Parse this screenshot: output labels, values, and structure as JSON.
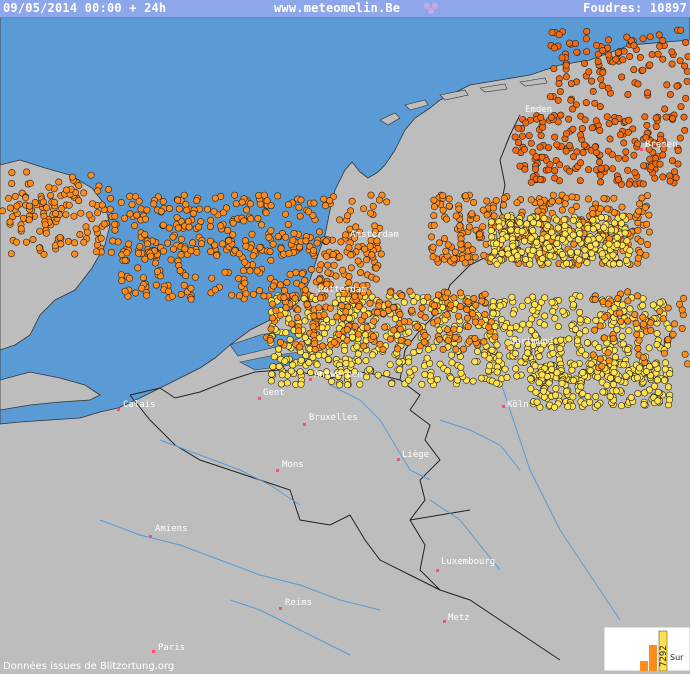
{
  "header": {
    "datetime": "09/05/2014 00:00 + 24h",
    "site": "www.meteomelin.Be",
    "strikes_label": "Foudres: 10897"
  },
  "footer": {
    "source": "Données issues de Blitzortung.org"
  },
  "legend": {
    "histogram_label": "7292",
    "side_label": "Sur"
  },
  "colors": {
    "sea": "#5b9bd5",
    "land": "#bdbdbd",
    "recent_strike": "#ffe14d",
    "older_strike": "#ff8c1a",
    "oldest_strike": "#f26a0f"
  },
  "cities": [
    {
      "id": "emden",
      "label": "Emden"
    },
    {
      "id": "bremen",
      "label": "Bremen"
    },
    {
      "id": "amsterdam",
      "label": "Amsterdam"
    },
    {
      "id": "rotterdam",
      "label": "Rotterdam"
    },
    {
      "id": "dortmund",
      "label": "Dortmund"
    },
    {
      "id": "antwerpen",
      "label": "Antwerpen"
    },
    {
      "id": "gent",
      "label": "Gent"
    },
    {
      "id": "calais",
      "label": "Calais"
    },
    {
      "id": "bruxelles",
      "label": "Bruxelles"
    },
    {
      "id": "koln",
      "label": "Köln"
    },
    {
      "id": "liege",
      "label": "Liège"
    },
    {
      "id": "mons",
      "label": "Mons"
    },
    {
      "id": "amiens",
      "label": "Amiens"
    },
    {
      "id": "luxembourg",
      "label": "Luxembourg"
    },
    {
      "id": "reims",
      "label": "Reims"
    },
    {
      "id": "metz",
      "label": "Metz"
    },
    {
      "id": "paris",
      "label": "Paris"
    }
  ]
}
